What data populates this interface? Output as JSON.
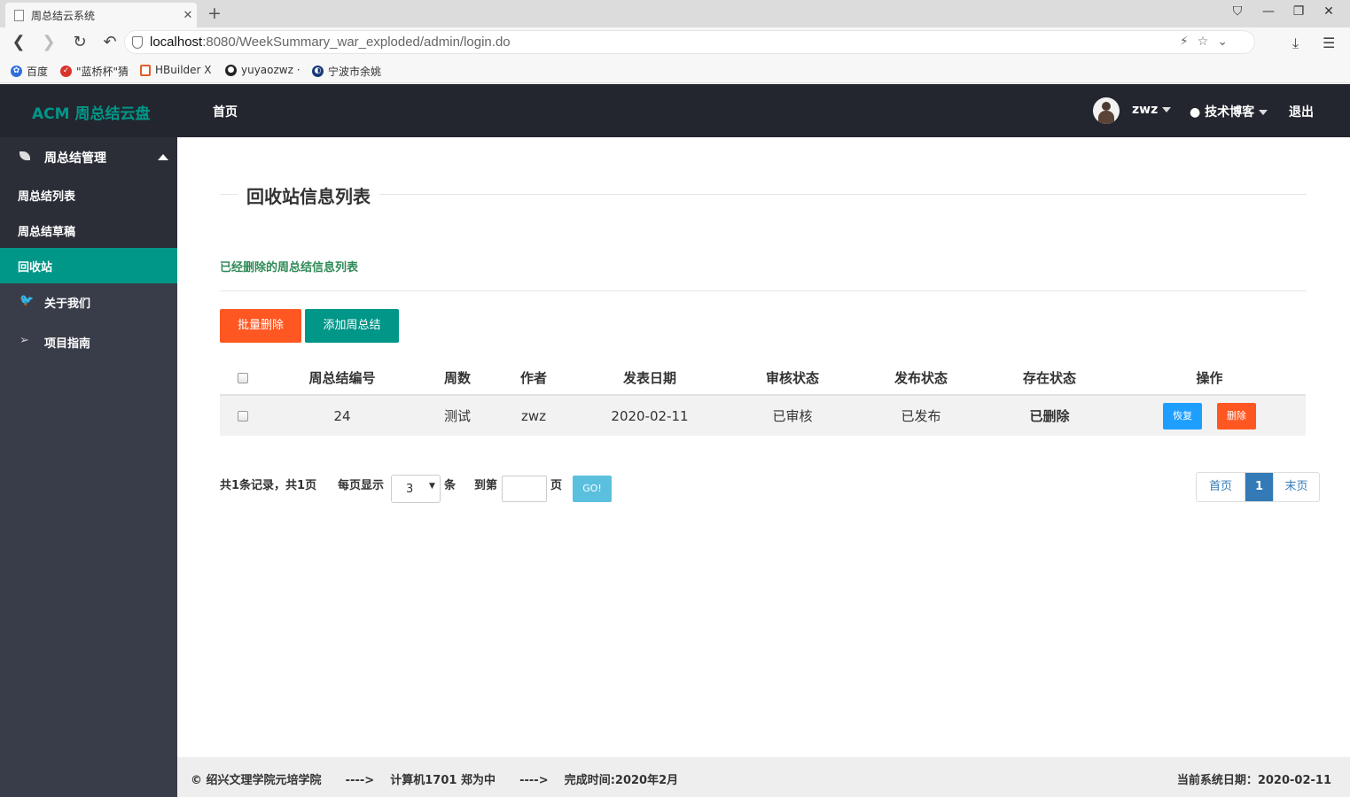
{
  "browser": {
    "tab_title": "周总结云系统",
    "url_host": "localhost",
    "url_rest": ":8080/WeekSummary_war_exploded/admin/login.do",
    "bookmarks": [
      "百度",
      "\"蓝桥杯\"猜",
      "HBuilder X",
      "yuyaozwz ·",
      "宁波市余姚"
    ]
  },
  "header": {
    "logo": "ACM 周总结云盘",
    "nav_home": "首页",
    "user": "zwz",
    "blog": "技术博客",
    "logout": "退出"
  },
  "sidebar": {
    "group": "周总结管理",
    "subitems": [
      "周总结列表",
      "周总结草稿",
      "回收站"
    ],
    "items": [
      "关于我们",
      "项目指南"
    ]
  },
  "main": {
    "title": "回收站信息列表",
    "subtitle": "已经删除的周总结信息列表",
    "btn_batch_delete": "批量删除",
    "btn_add": "添加周总结",
    "columns": [
      "周总结编号",
      "周数",
      "作者",
      "发表日期",
      "审核状态",
      "发布状态",
      "存在状态",
      "操作"
    ],
    "rows": [
      {
        "id": "24",
        "week": "测试",
        "author": "zwz",
        "date": "2020-02-11",
        "review": "已审核",
        "publish": "已发布",
        "exist": "已删除",
        "restore": "恢复",
        "delete": "删除"
      }
    ]
  },
  "pager": {
    "summary": "共1条记录，共1页",
    "per_page_label": "每页显示",
    "per_page_value": "3",
    "unit": "条",
    "goto_label": "到第",
    "page_unit": "页",
    "go": "GO!",
    "first": "首页",
    "current": "1",
    "last": "末页"
  },
  "footer": {
    "left": "© 绍兴文理学院元培学院      ---->    计算机1701 郑为中      ---->    完成时间:2020年2月",
    "right": "当前系统日期：2020-02-11"
  },
  "colors": {
    "header_bg": "#23262e",
    "sidebar_bg": "#393d49",
    "accent_teal": "#009688",
    "danger_orange": "#ff5722",
    "info_blue": "#1e9fff"
  }
}
